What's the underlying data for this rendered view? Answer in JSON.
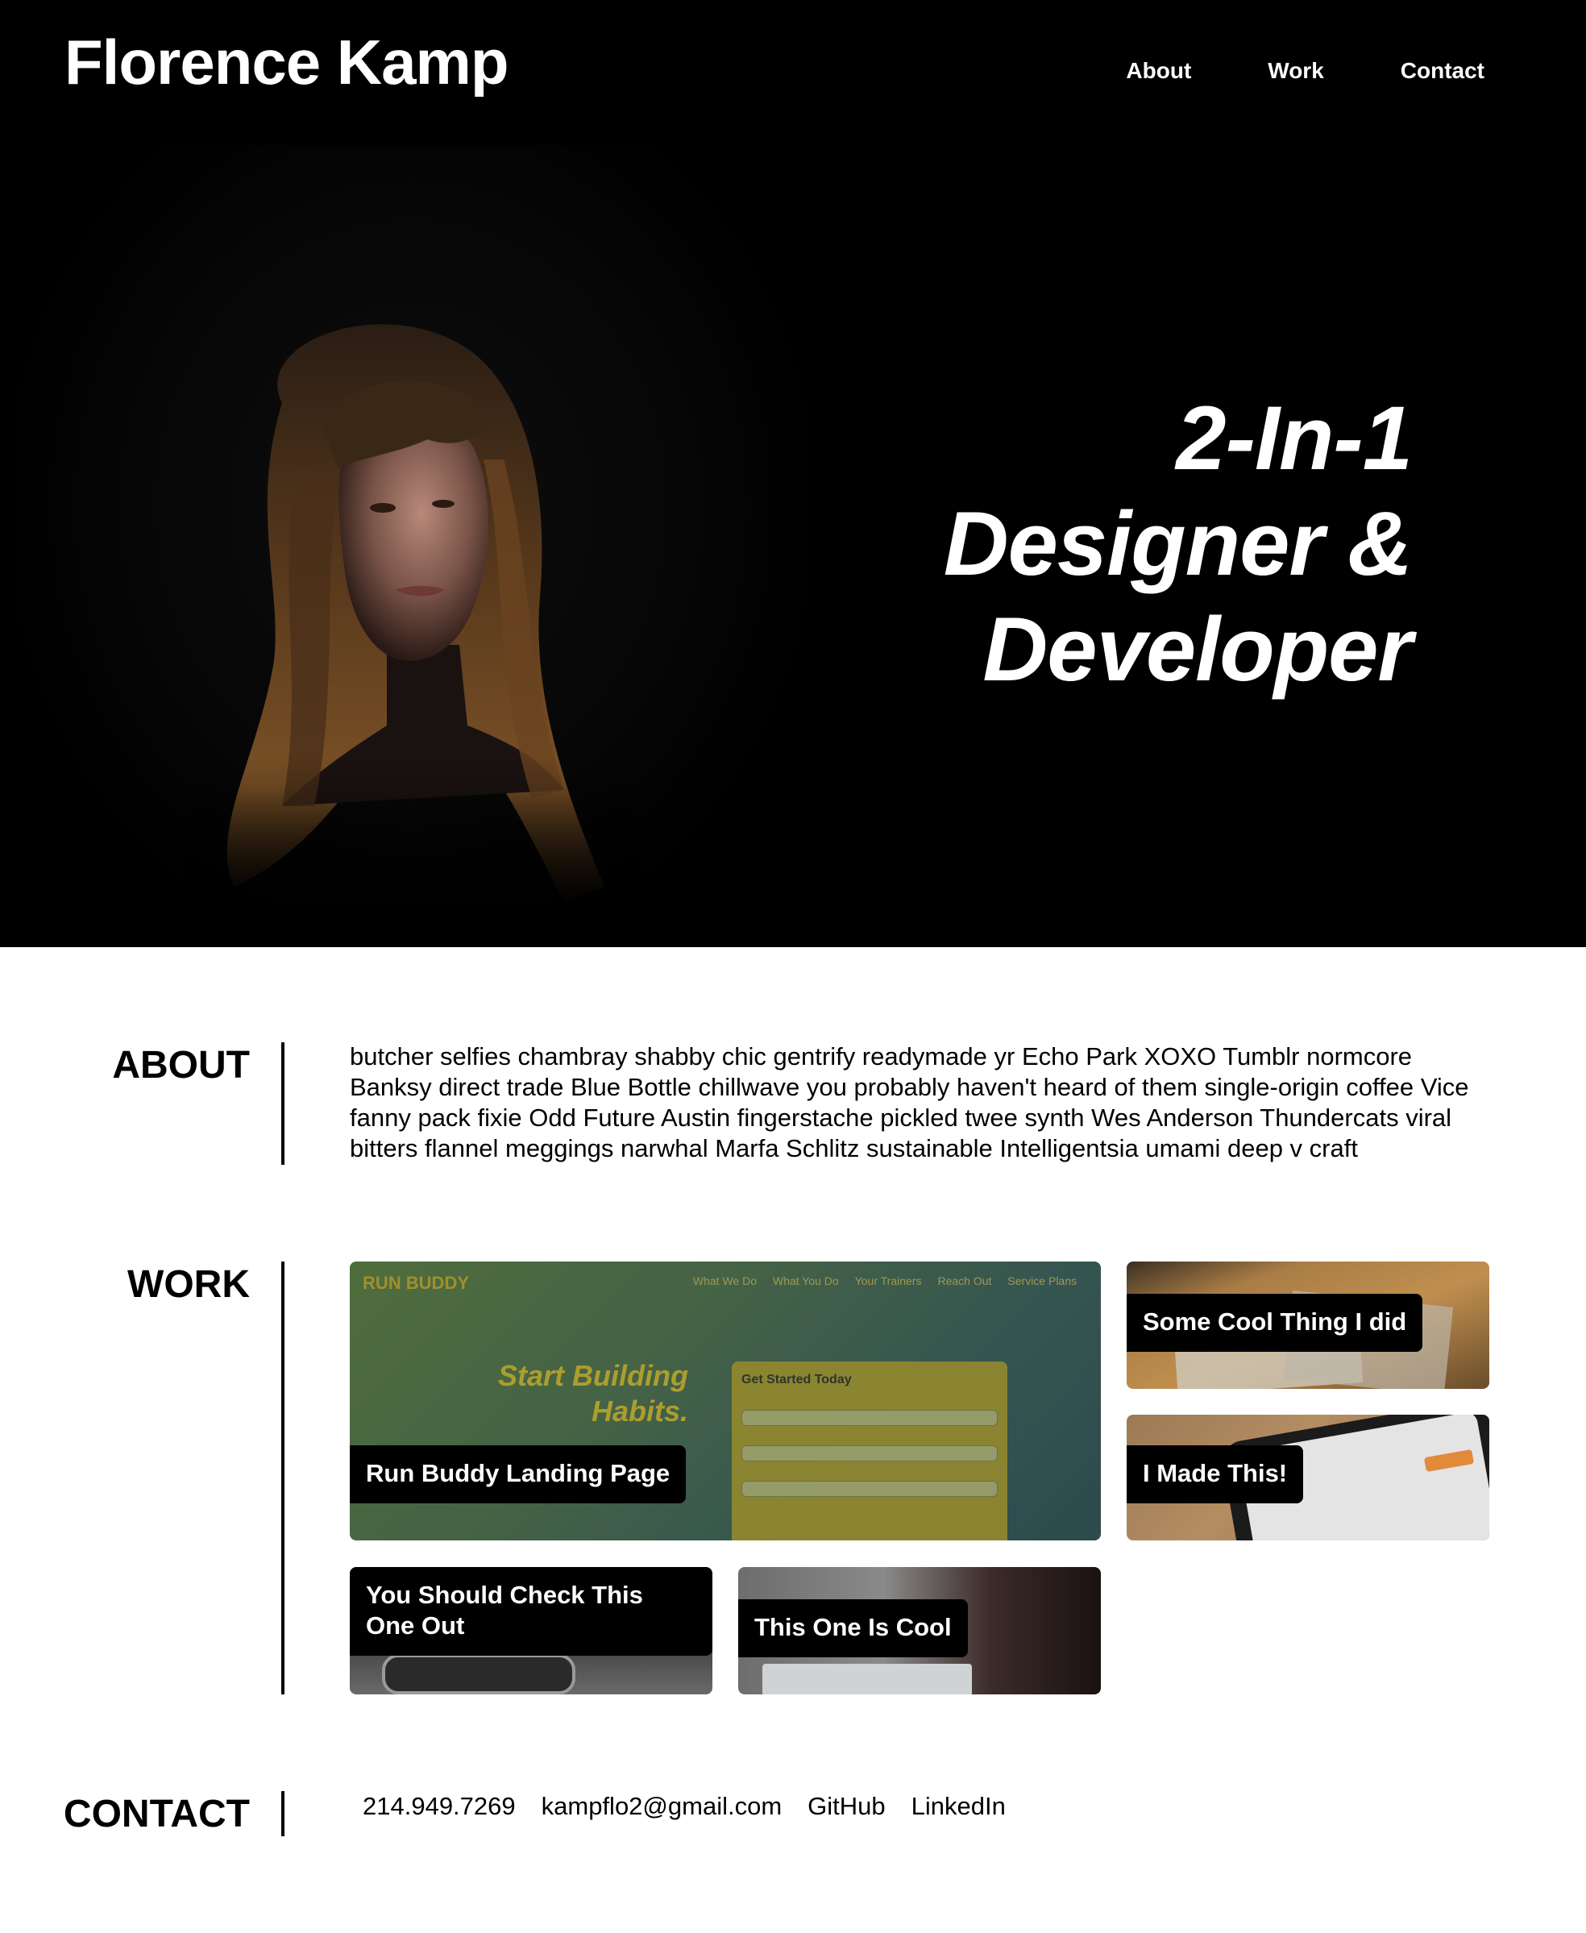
{
  "header": {
    "site_name": "Florence Kamp",
    "nav": [
      {
        "label": "About"
      },
      {
        "label": "Work"
      },
      {
        "label": "Contact"
      }
    ]
  },
  "hero": {
    "headline_lines": [
      "2-In-1",
      "Designer &",
      "Developer"
    ],
    "portrait_alt": "Portrait of Florence Kamp"
  },
  "about": {
    "heading": "ABOUT",
    "text": "butcher selfies chambray shabby chic gentrify readymade yr Echo Park XOXO Tumblr normcore Banksy direct trade Blue Bottle chillwave you probably haven't heard of them single-origin coffee Vice fanny pack fixie Odd Future Austin fingerstache pickled twee synth Wes Anderson Thundercats viral bitters flannel meggings narwhal Marfa Schlitz sustainable Intelligentsia umami deep v craft"
  },
  "work": {
    "heading": "WORK",
    "projects": [
      {
        "title": "Run Buddy Landing Page"
      },
      {
        "title": "Some Cool Thing I did"
      },
      {
        "title": "I Made This!"
      },
      {
        "title": "You Should Check This One Out"
      },
      {
        "title": "This One Is Cool"
      }
    ],
    "run_buddy_preview": {
      "logo": "RUN BUDDY",
      "nav": [
        "What We Do",
        "What You Do",
        "Your Trainers",
        "Reach Out",
        "Service Plans"
      ],
      "hero_lines": [
        "Start Building",
        "Habits."
      ],
      "form_title": "Get Started Today"
    }
  },
  "contact": {
    "heading": "CONTACT",
    "links": [
      {
        "label": "214.949.7269"
      },
      {
        "label": "kampflo2@gmail.com"
      },
      {
        "label": "GitHub"
      },
      {
        "label": "LinkedIn"
      }
    ]
  },
  "colors": {
    "hero_bg": "#000000",
    "page_bg": "#ffffff",
    "label_bg": "#000000",
    "text_light": "#ffffff"
  }
}
